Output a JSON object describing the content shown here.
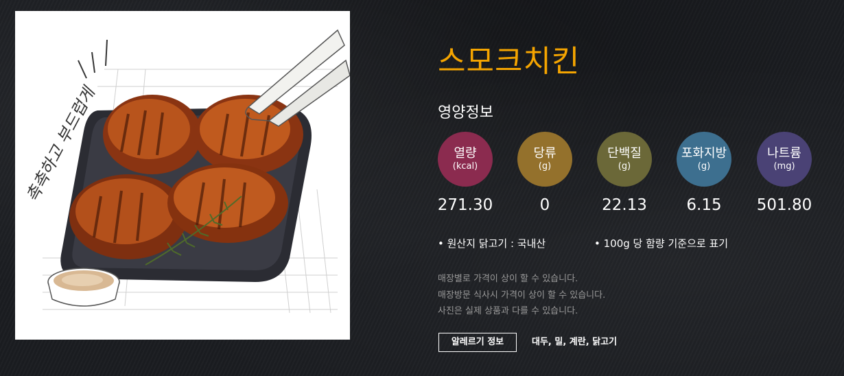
{
  "product": {
    "title": "스모크치킨",
    "image_alt": "스모크치킨 제품 사진",
    "image_handwriting": "촉촉하고 부드럽게"
  },
  "nutrition": {
    "title": "영양정보",
    "items": [
      {
        "name": "열량",
        "unit": "(kcal)",
        "value": "271.30",
        "color": "#8b2b4f"
      },
      {
        "name": "당류",
        "unit": "(g)",
        "value": "0",
        "color": "#94712c"
      },
      {
        "name": "단백질",
        "unit": "(g)",
        "value": "22.13",
        "color": "#6b6838"
      },
      {
        "name": "포화지방",
        "unit": "(g)",
        "value": "6.15",
        "color": "#3d6f8f"
      },
      {
        "name": "나트륨",
        "unit": "(mg)",
        "value": "501.80",
        "color": "#4a4275"
      }
    ]
  },
  "notes": {
    "origin": "• 원산지 닭고기 : 국내산",
    "basis": "• 100g 당 함량 기준으로 표기"
  },
  "disclaimers": [
    "매장별로 가격이 상이 할 수 있습니다.",
    "매장방문 식사시 가격이 상이 할 수 있습니다.",
    "사진은 실제 상품과 다를 수 있습니다."
  ],
  "allergy": {
    "button_label": "알레르기 정보",
    "list": "대두, 밀, 계란, 닭고기"
  }
}
